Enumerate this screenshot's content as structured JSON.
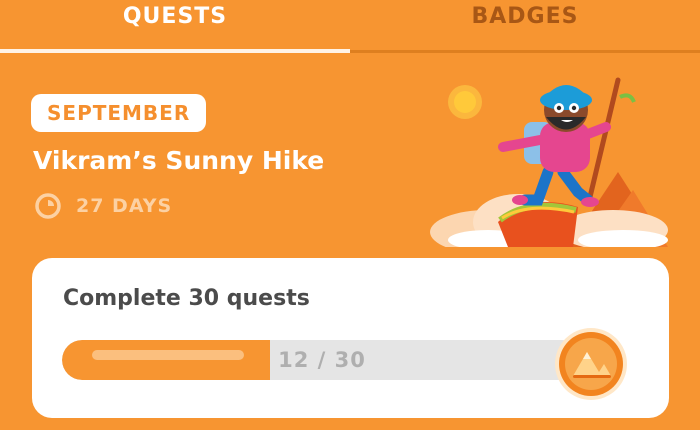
{
  "tabs": [
    {
      "label": "QUESTS",
      "active": true
    },
    {
      "label": "BADGES",
      "active": false
    }
  ],
  "challenge": {
    "month": "SEPTEMBER",
    "title": "Vikram’s Sunny Hike",
    "days_left": "27 DAYS",
    "timer_icon": "timer-icon"
  },
  "quest": {
    "title": "Complete 30 quests",
    "progress_text": "12 / 30",
    "progress_value": 12,
    "progress_total": 30,
    "reward_icon": "mountain-badge-icon"
  },
  "colors": {
    "background": "#F79531",
    "progress_fill": "#F79531",
    "progress_track": "#E5E5E5",
    "inactive_tab": "#A85715"
  }
}
